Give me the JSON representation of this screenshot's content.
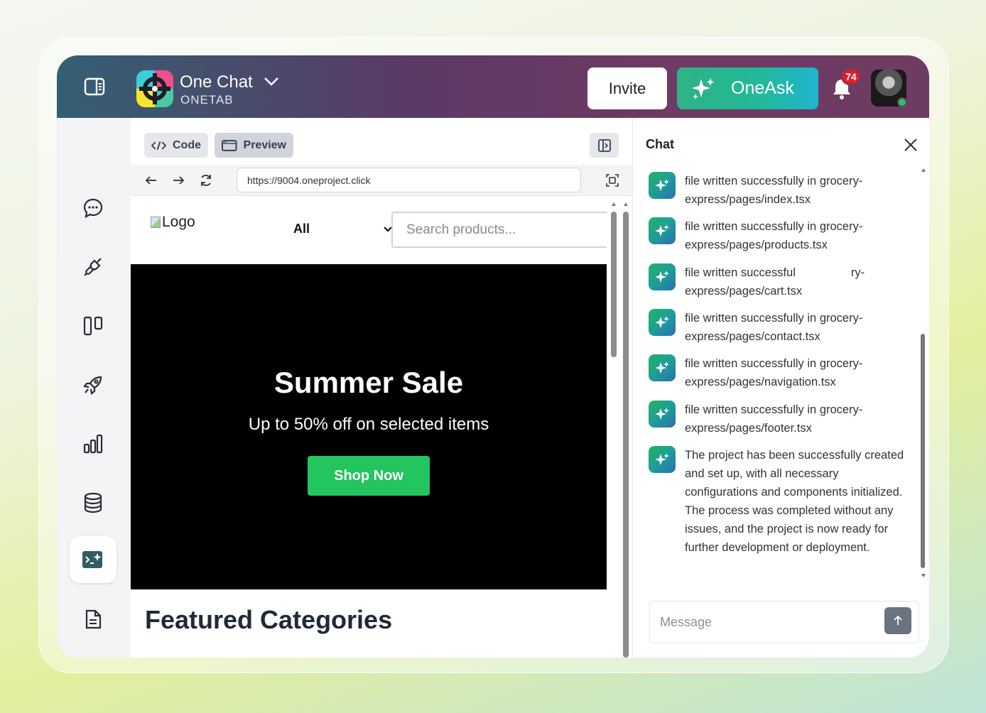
{
  "header": {
    "brand_name": "One Chat",
    "brand_sub": "ONETAB",
    "invite_label": "Invite",
    "oneask_label": "OneAsk",
    "notification_count": "74"
  },
  "sidebar": {
    "items": [
      {
        "name": "chat"
      },
      {
        "name": "integrations"
      },
      {
        "name": "boards"
      },
      {
        "name": "launch"
      },
      {
        "name": "analytics"
      },
      {
        "name": "database"
      },
      {
        "name": "code-builder",
        "active": true
      },
      {
        "name": "documents"
      },
      {
        "name": "settings"
      }
    ]
  },
  "editor": {
    "code_tab": "Code",
    "preview_tab": "Preview",
    "url": "https://9004.oneproject.click"
  },
  "site": {
    "logo_alt": "Logo",
    "category_select": "All",
    "search_placeholder": "Search products...",
    "hero_title": "Summer Sale",
    "hero_subtitle": "Up to 50% off on selected items",
    "hero_button": "Shop Now",
    "featured_title": "Featured Categories"
  },
  "chat": {
    "title": "Chat",
    "messages": [
      "file written successfully in grocery-express/pages/index.tsx",
      "file written successfully in grocery-express/pages/products.tsx",
      "file written successful                 ry-express/pages/cart.tsx",
      "file written successfully in grocery-express/pages/contact.tsx",
      "file written successfully in grocery-express/pages/navigation.tsx",
      "file written successfully in grocery-express/pages/footer.tsx",
      "The project has been successfully created and set up, with all necessary configurations and components initialized. The process was completed without any issues, and the project is now ready for further development or deployment."
    ],
    "input_placeholder": "Message"
  },
  "colors": {
    "accent_green": "#22c55e",
    "badge_red": "#e11d2a",
    "topbar_start": "#345f74",
    "topbar_end": "#6e3b63"
  }
}
